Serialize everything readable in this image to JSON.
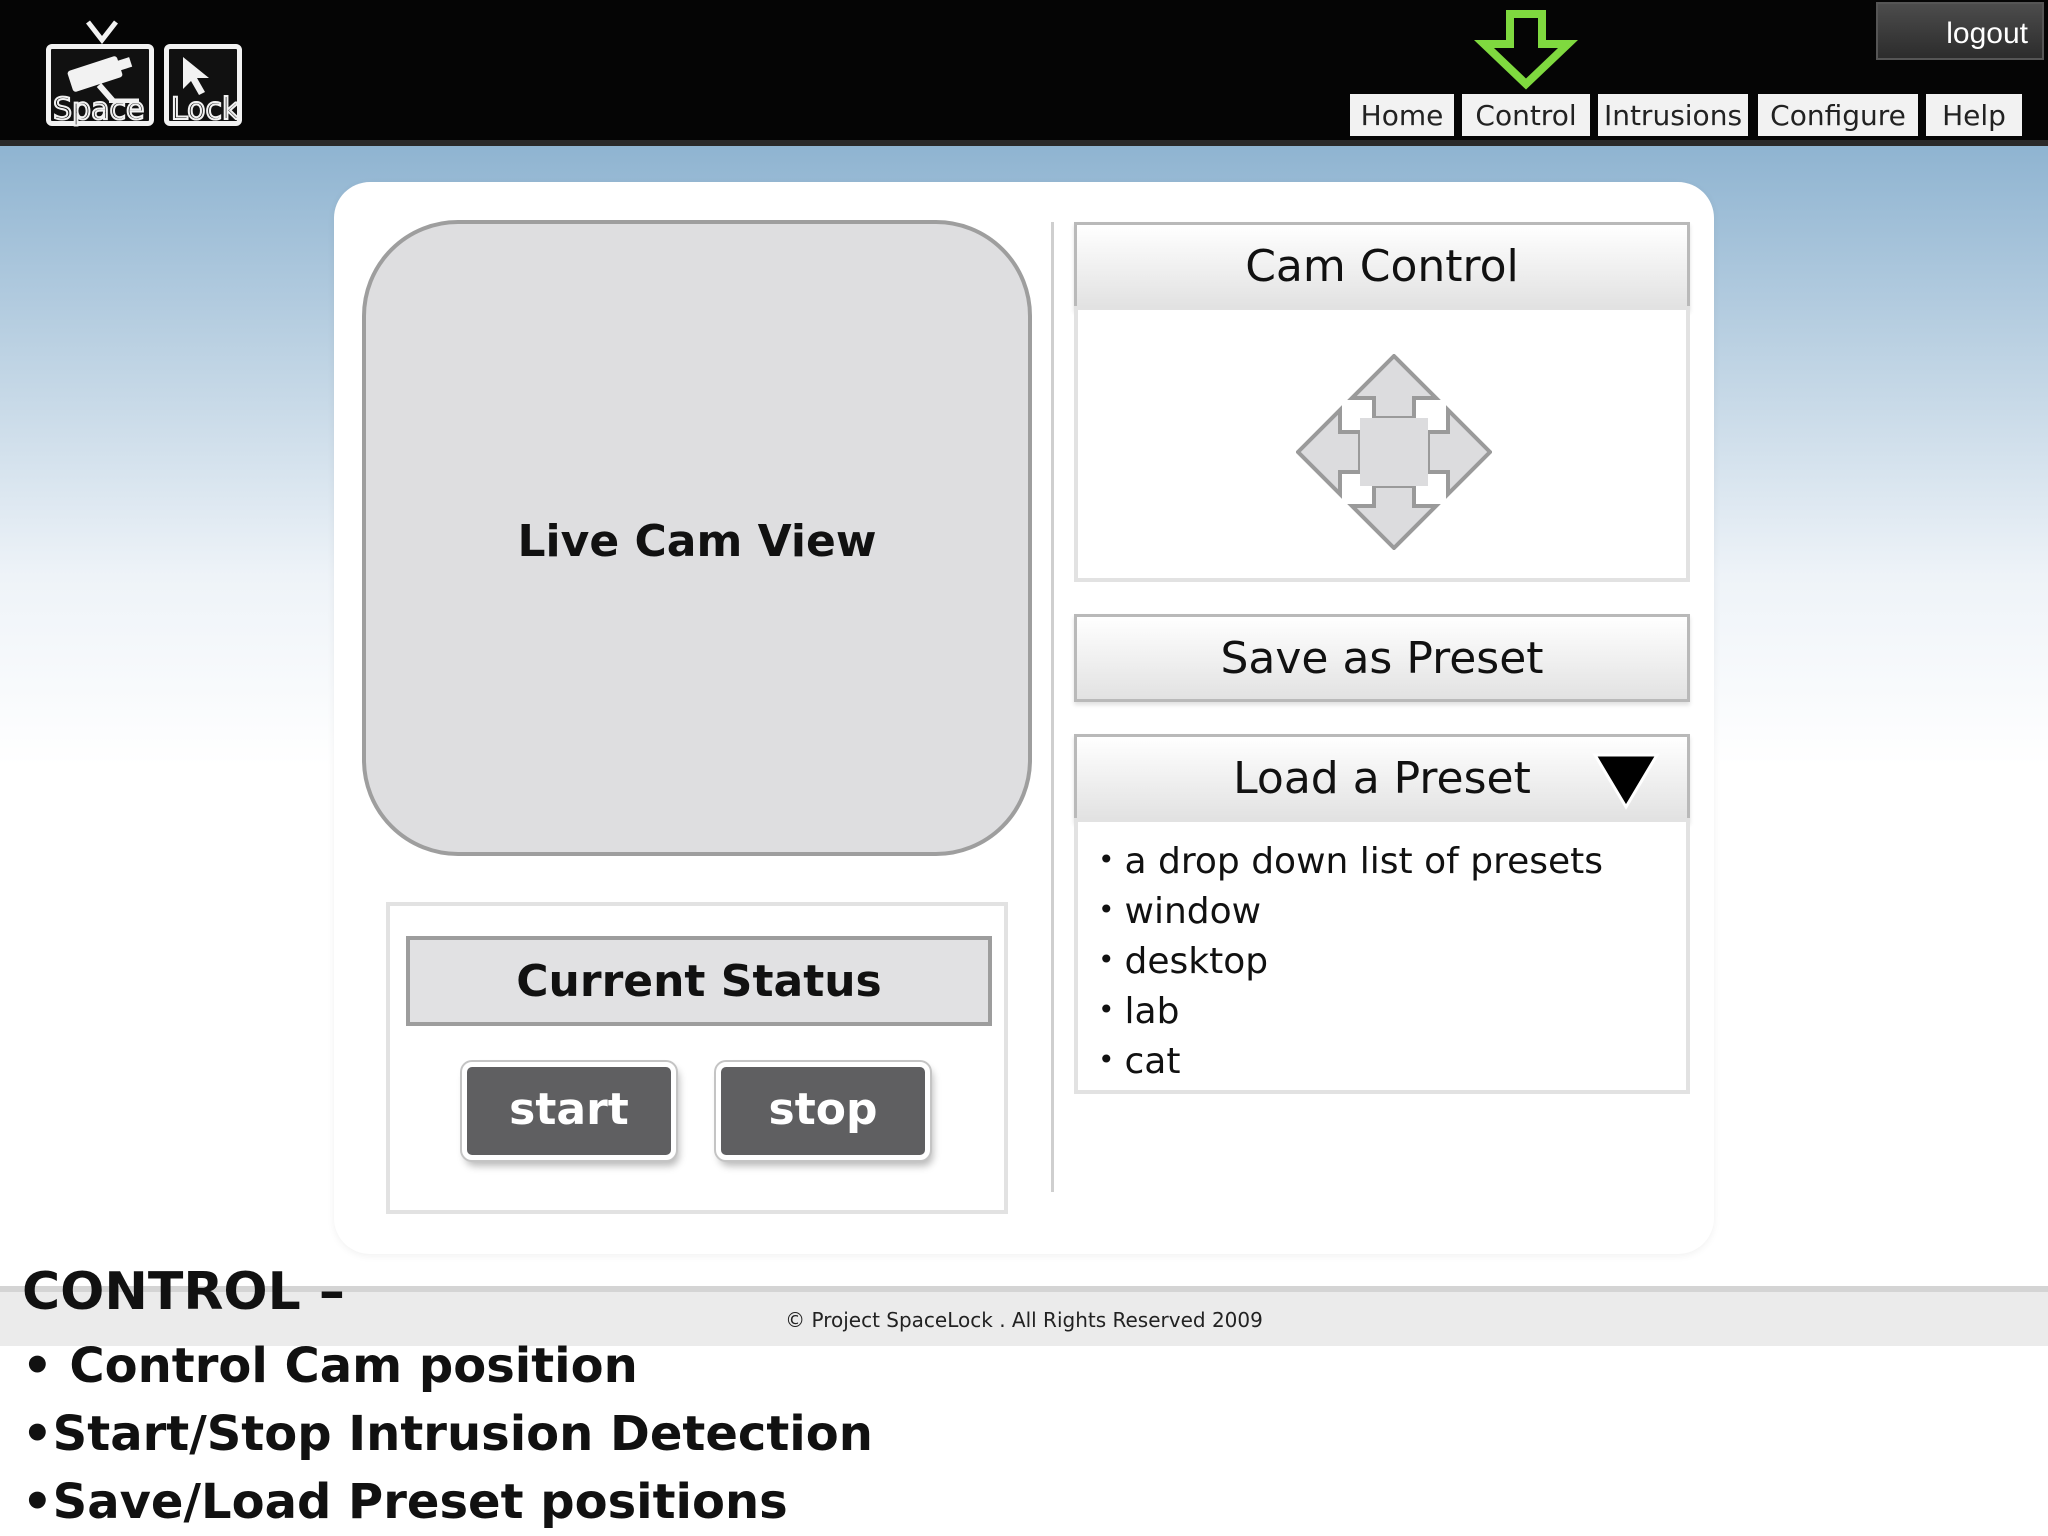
{
  "header": {
    "logo_word_1": "Space",
    "logo_word_2": "Lock",
    "logout_label": "logout",
    "nav": [
      {
        "label": "Home"
      },
      {
        "label": "Control"
      },
      {
        "label": "Intrusions"
      },
      {
        "label": "Configure"
      },
      {
        "label": "Help"
      }
    ],
    "active_nav": "Control",
    "active_indicator_color": "#7fd93f"
  },
  "live_cam": {
    "label": "Live Cam View"
  },
  "status": {
    "title": "Current Status",
    "start_label": "start",
    "stop_label": "stop"
  },
  "cam_control": {
    "title": "Cam Control",
    "icon": "move-arrows-icon"
  },
  "save_preset": {
    "label": "Save as Preset"
  },
  "load_preset": {
    "label": "Load a Preset",
    "icon": "dropdown-triangle-icon",
    "items": [
      "a drop down list of presets",
      "window",
      "desktop",
      "lab",
      "cat"
    ]
  },
  "footer": {
    "copyright": "© Project SpaceLock . All Rights Reserved 2009"
  },
  "caption": {
    "title": "CONTROL –",
    "lines": [
      "• Control Cam position",
      "•Start/Stop Intrusion Detection",
      "•Save/Load Preset positions"
    ]
  }
}
